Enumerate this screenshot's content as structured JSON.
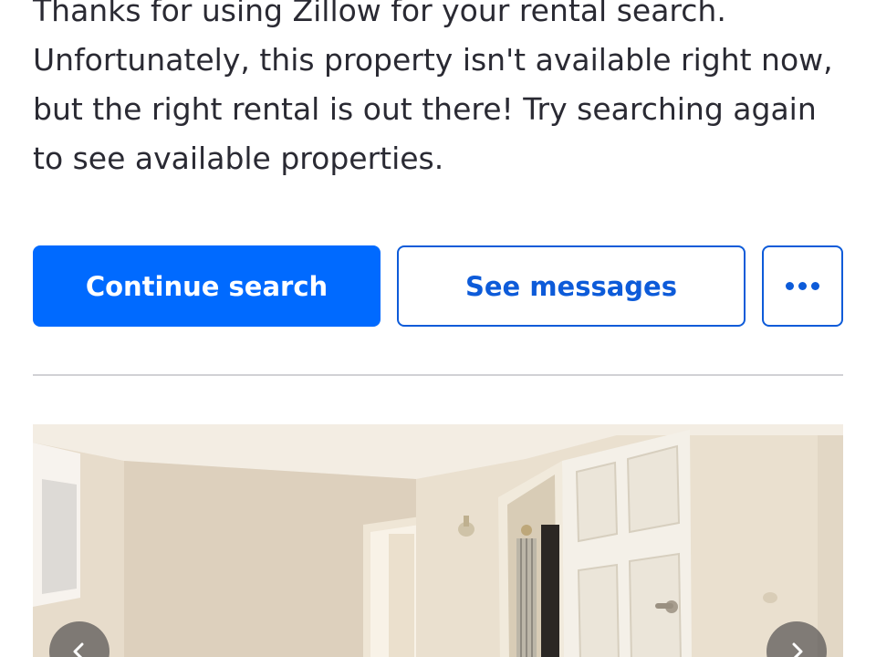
{
  "message": {
    "text": "Thanks for using Zillow for your rental search. Unfortunately, this property isn't available right now, but the right rental is out there! Try searching again to see available properties."
  },
  "actions": {
    "continue_label": "Continue search",
    "messages_label": "See messages",
    "more_icon": "more-dots-icon"
  },
  "photo": {
    "description_icon": "listing-photo",
    "prev_icon": "chevron-left-icon",
    "next_icon": "chevron-right-icon"
  },
  "colors": {
    "primary": "#006aff",
    "primary_outline": "#0d5bd9",
    "text": "#2a2a33",
    "divider": "#d1d1d5"
  }
}
